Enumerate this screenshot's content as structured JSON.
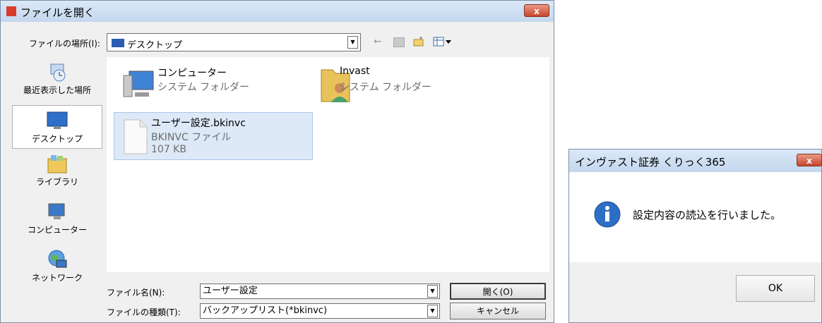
{
  "open_dialog": {
    "title": "ファイルを開く",
    "close_label": "x",
    "look_in_label": "ファイルの場所(I):",
    "look_in_value": "デスクトップ",
    "places": [
      {
        "label": "最近表示した場所",
        "icon": "recent-places-icon"
      },
      {
        "label": "デスクトップ",
        "icon": "desktop-icon"
      },
      {
        "label": "ライブラリ",
        "icon": "libraries-icon"
      },
      {
        "label": "コンピューター",
        "icon": "computer-icon"
      },
      {
        "label": "ネットワーク",
        "icon": "network-icon"
      }
    ],
    "items": [
      {
        "name": "コンピューター",
        "type": "システム フォルダー",
        "icon": "computer-icon"
      },
      {
        "name": "Invast",
        "type": "システム フォルダー",
        "icon": "user-folder-icon"
      },
      {
        "name": "ユーザー設定.bkinvc",
        "type": "BKINVC ファイル",
        "size": "107 KB",
        "icon": "file-icon"
      }
    ],
    "file_name_label": "ファイル名(N):",
    "file_name_value": "ユーザー設定",
    "file_type_label": "ファイルの種類(T):",
    "file_type_value": "バックアップリスト(*bkinvc)",
    "open_button": "開く(O)",
    "cancel_button": "キャンセル"
  },
  "message_box": {
    "title": "インヴァスト証券 くりっく365",
    "close_label": "x",
    "message": "設定内容の読込を行いました。",
    "ok_button": "OK"
  },
  "colors": {
    "accent": "#3c7fc4",
    "close": "#c7462c",
    "selection": "#dde9f7"
  }
}
